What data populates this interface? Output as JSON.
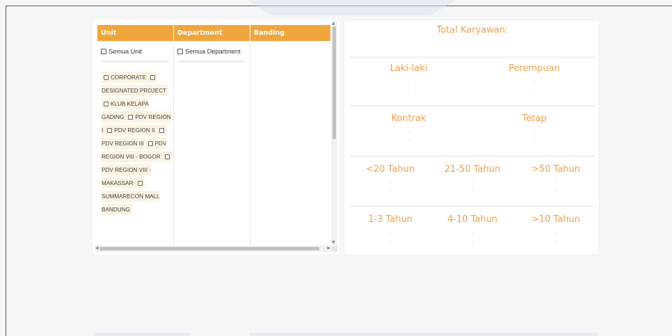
{
  "table": {
    "headers": {
      "unit": "Unit",
      "department": "Department",
      "banding": "Banding"
    },
    "all_unit_label": "Semua Unit",
    "all_department_label": "Semua Department",
    "units": [
      "CORPORATE",
      "DESIGNATED PROJECT",
      "KLUB KELAPA GADING",
      "PDV REGION I",
      "PDV REGION II",
      "PDV REGION III",
      "PDV REGION VIII - BOGOR",
      "PDV REGION VIII - MAKASSAR",
      "SUMMARECON MALL BANDUNG"
    ],
    "header_color": "#f0a63c",
    "item_bg": "#fbf3e2"
  },
  "stats": {
    "accent_color": "#f0a050",
    "total": {
      "label": "Total Karyawan:",
      "value": "-"
    },
    "gender": [
      {
        "label": "Laki-laki",
        "v1": "-",
        "v2": "-"
      },
      {
        "label": "Perempuan",
        "v1": "-",
        "v2": "-"
      }
    ],
    "status": [
      {
        "label": "Kontrak",
        "v1": "-",
        "v2": "-"
      },
      {
        "label": "Tetap",
        "v1": "-",
        "v2": "-"
      }
    ],
    "age": [
      {
        "label": "<20 Tahun",
        "v1": "-",
        "v2": "-"
      },
      {
        "label": "21-50 Tahun",
        "v1": "-",
        "v2": "-"
      },
      {
        "label": ">50 Tahun",
        "v1": "-",
        "v2": "-"
      }
    ],
    "tenure": [
      {
        "label": "1-3 Tahun",
        "v1": "-",
        "v2": "-"
      },
      {
        "label": "4-10 Tahun",
        "v1": "-",
        "v2": "-"
      },
      {
        "label": ">10 Tahun",
        "v1": "-",
        "v2": "-"
      }
    ]
  }
}
